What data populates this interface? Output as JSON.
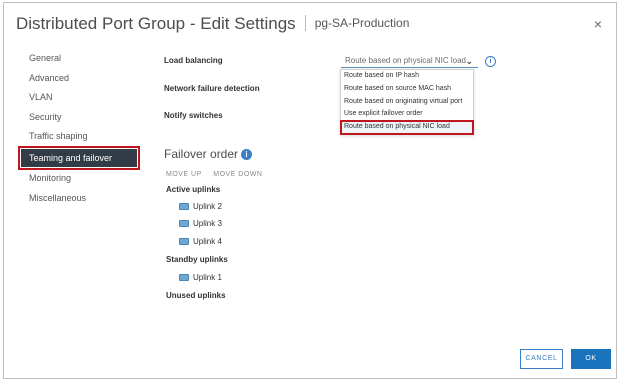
{
  "dialog": {
    "title": "Distributed Port Group - Edit Settings",
    "object_name": "pg-SA-Production",
    "close_glyph": "×"
  },
  "nav": {
    "items": [
      {
        "label": "General"
      },
      {
        "label": "Advanced"
      },
      {
        "label": "VLAN"
      },
      {
        "label": "Security"
      },
      {
        "label": "Traffic shaping"
      },
      {
        "label": "Teaming and failover",
        "active": true
      },
      {
        "label": "Monitoring"
      },
      {
        "label": "Miscellaneous"
      }
    ]
  },
  "form": {
    "load_balancing_label": "Load balancing",
    "network_failure_label": "Network failure detection",
    "notify_switches_label": "Notify switches",
    "load_balancing_value": "Route based on physical NIC load",
    "dropdown_options": [
      "Route based on IP hash",
      "Route based on source MAC hash",
      "Route based on originating virtual port",
      "Use explicit failover order",
      "Route based on physical NIC load"
    ],
    "highlighted_option": "Route based on physical NIC load"
  },
  "failover": {
    "heading": "Failover order",
    "move_up": "MOVE UP",
    "move_down": "MOVE DOWN",
    "active_label": "Active uplinks",
    "active": [
      "Uplink 2",
      "Uplink 3",
      "Uplink 4"
    ],
    "standby_label": "Standby uplinks",
    "standby": [
      "Uplink 1"
    ],
    "unused_label": "Unused uplinks"
  },
  "buttons": {
    "cancel": "CANCEL",
    "ok": "OK"
  },
  "icons": {
    "info": "info-icon",
    "help": "help-icon",
    "uplink": "nic-icon",
    "close": "close-icon",
    "chevron": "chevron-down-icon"
  },
  "colors": {
    "accent": "#1a73bd",
    "nav_active_bg": "#313c47",
    "highlight_border": "#c0171f"
  }
}
